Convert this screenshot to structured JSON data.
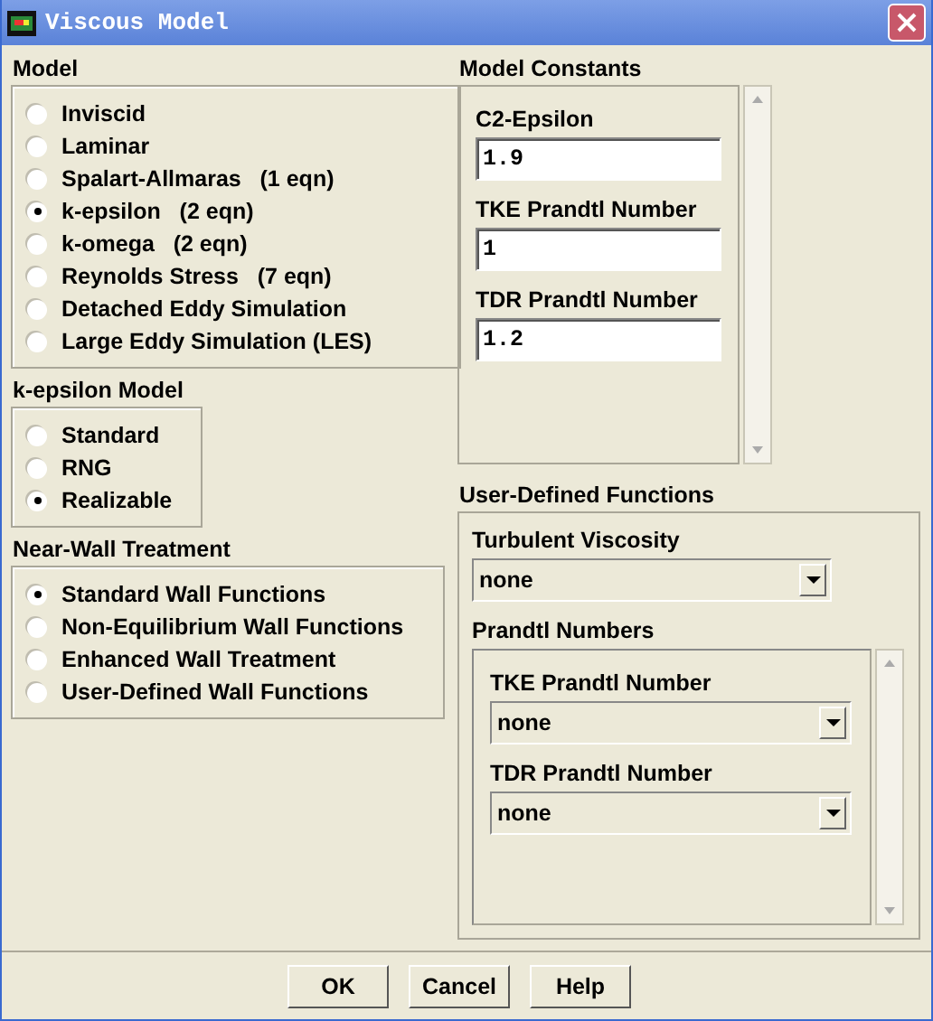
{
  "window": {
    "title": "Viscous Model"
  },
  "model": {
    "title": "Model",
    "options": [
      {
        "label": "Inviscid",
        "selected": false
      },
      {
        "label": "Laminar",
        "selected": false
      },
      {
        "label": "Spalart-Allmaras   (1 eqn)",
        "selected": false
      },
      {
        "label": "k-epsilon   (2 eqn)",
        "selected": true
      },
      {
        "label": "k-omega   (2 eqn)",
        "selected": false
      },
      {
        "label": "Reynolds Stress   (7 eqn)",
        "selected": false
      },
      {
        "label": "Detached Eddy Simulation",
        "selected": false
      },
      {
        "label": "Large Eddy Simulation (LES)",
        "selected": false
      }
    ]
  },
  "k_epsilon_model": {
    "title": "k-epsilon Model",
    "options": [
      {
        "label": "Standard",
        "selected": false
      },
      {
        "label": "RNG",
        "selected": false
      },
      {
        "label": "Realizable",
        "selected": true
      }
    ]
  },
  "near_wall_treatment": {
    "title": "Near-Wall Treatment",
    "options": [
      {
        "label": "Standard Wall Functions",
        "selected": true
      },
      {
        "label": "Non-Equilibrium Wall Functions",
        "selected": false
      },
      {
        "label": "Enhanced Wall Treatment",
        "selected": false
      },
      {
        "label": "User-Defined Wall Functions",
        "selected": false
      }
    ]
  },
  "model_constants": {
    "title": "Model Constants",
    "fields": [
      {
        "label": "C2-Epsilon",
        "value": "1.9"
      },
      {
        "label": "TKE Prandtl Number",
        "value": "1"
      },
      {
        "label": "TDR Prandtl Number",
        "value": "1.2"
      }
    ]
  },
  "user_defined_functions": {
    "title": "User-Defined Functions",
    "turbulent_viscosity": {
      "label": "Turbulent Viscosity",
      "value": "none"
    },
    "prandtl_numbers": {
      "title": "Prandtl Numbers",
      "fields": [
        {
          "label": "TKE Prandtl Number",
          "value": "none"
        },
        {
          "label": "TDR Prandtl Number",
          "value": "none"
        }
      ]
    }
  },
  "buttons": [
    "OK",
    "Cancel",
    "Help"
  ]
}
